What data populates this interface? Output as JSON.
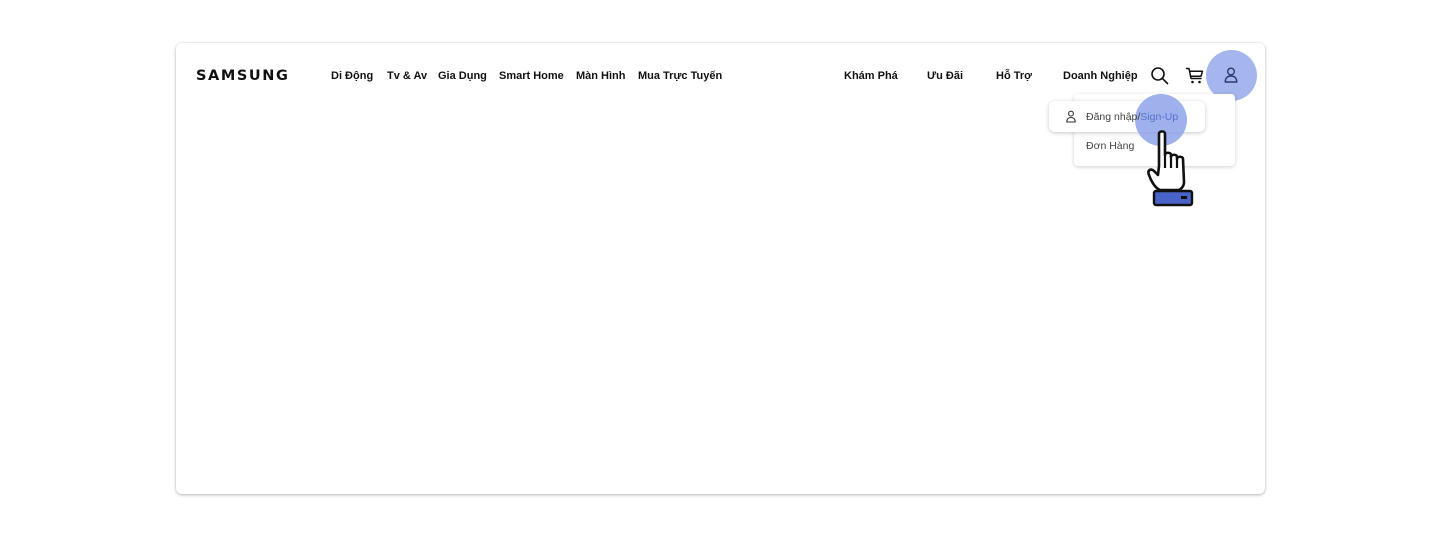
{
  "brand": {
    "logo_text": "SAMSUNG"
  },
  "nav": {
    "primary": [
      "Di Động",
      "Tv & Av",
      "Gia Dụng",
      "Smart Home",
      "Màn Hình",
      "Mua Trực Tuyến"
    ],
    "secondary": [
      "Khám Phá",
      "Ưu Đãi",
      "Hỗ Trợ",
      "Doanh Nghiệp"
    ]
  },
  "header_icons": [
    "search-icon",
    "cart-icon",
    "user-icon"
  ],
  "user_menu": {
    "login_label": "Đăng nhập/",
    "signup_label": "Sign-Up",
    "orders_label": "Đơn Hàng"
  },
  "colors": {
    "highlight": "#9fb2ec",
    "signup_text": "#5a6fd0",
    "cursor_cuff": "#4a63c9"
  }
}
